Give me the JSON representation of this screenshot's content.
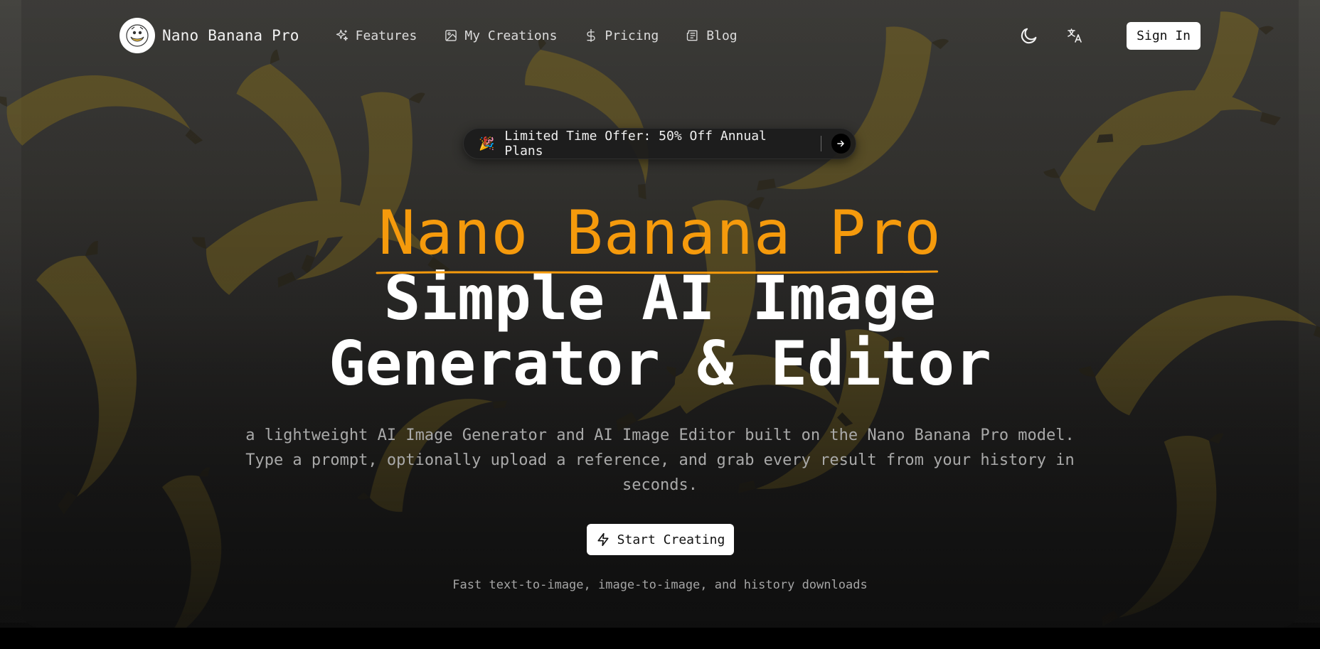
{
  "brand": {
    "name": "Nano Banana Pro",
    "logo_icon": "banana-mascot-logo-icon"
  },
  "nav": {
    "links": [
      {
        "label": "Features",
        "icon": "sparkles-icon"
      },
      {
        "label": "My Creations",
        "icon": "image-icon"
      },
      {
        "label": "Pricing",
        "icon": "dollar-icon"
      },
      {
        "label": "Blog",
        "icon": "newspaper-icon"
      }
    ],
    "theme_toggle_icon": "moon-icon",
    "language_icon": "translate-icon",
    "sign_in_label": "Sign In"
  },
  "offer": {
    "emoji": "🎉",
    "text": "Limited Time Offer: 50% Off Annual Plans",
    "arrow_icon": "arrow-right-icon"
  },
  "hero": {
    "title": "Nano Banana Pro",
    "subtitle_line1": "Simple AI Image",
    "subtitle_line2": "Generator & Editor",
    "description_line1": "a lightweight AI Image Generator and AI Image Editor built on the Nano Banana Pro model.",
    "description_line2": "Type a prompt, optionally upload a reference, and grab every result from your history in",
    "description_line3": "seconds.",
    "cta_label": "Start Creating",
    "cta_icon": "lightning-icon",
    "tagline": "Fast text-to-image, image-to-image, and history downloads"
  },
  "colors": {
    "accent": "#f59a0c",
    "background": "#2e2d2b",
    "button_bg": "#ffffff",
    "muted_text": "#a9a9a9"
  }
}
